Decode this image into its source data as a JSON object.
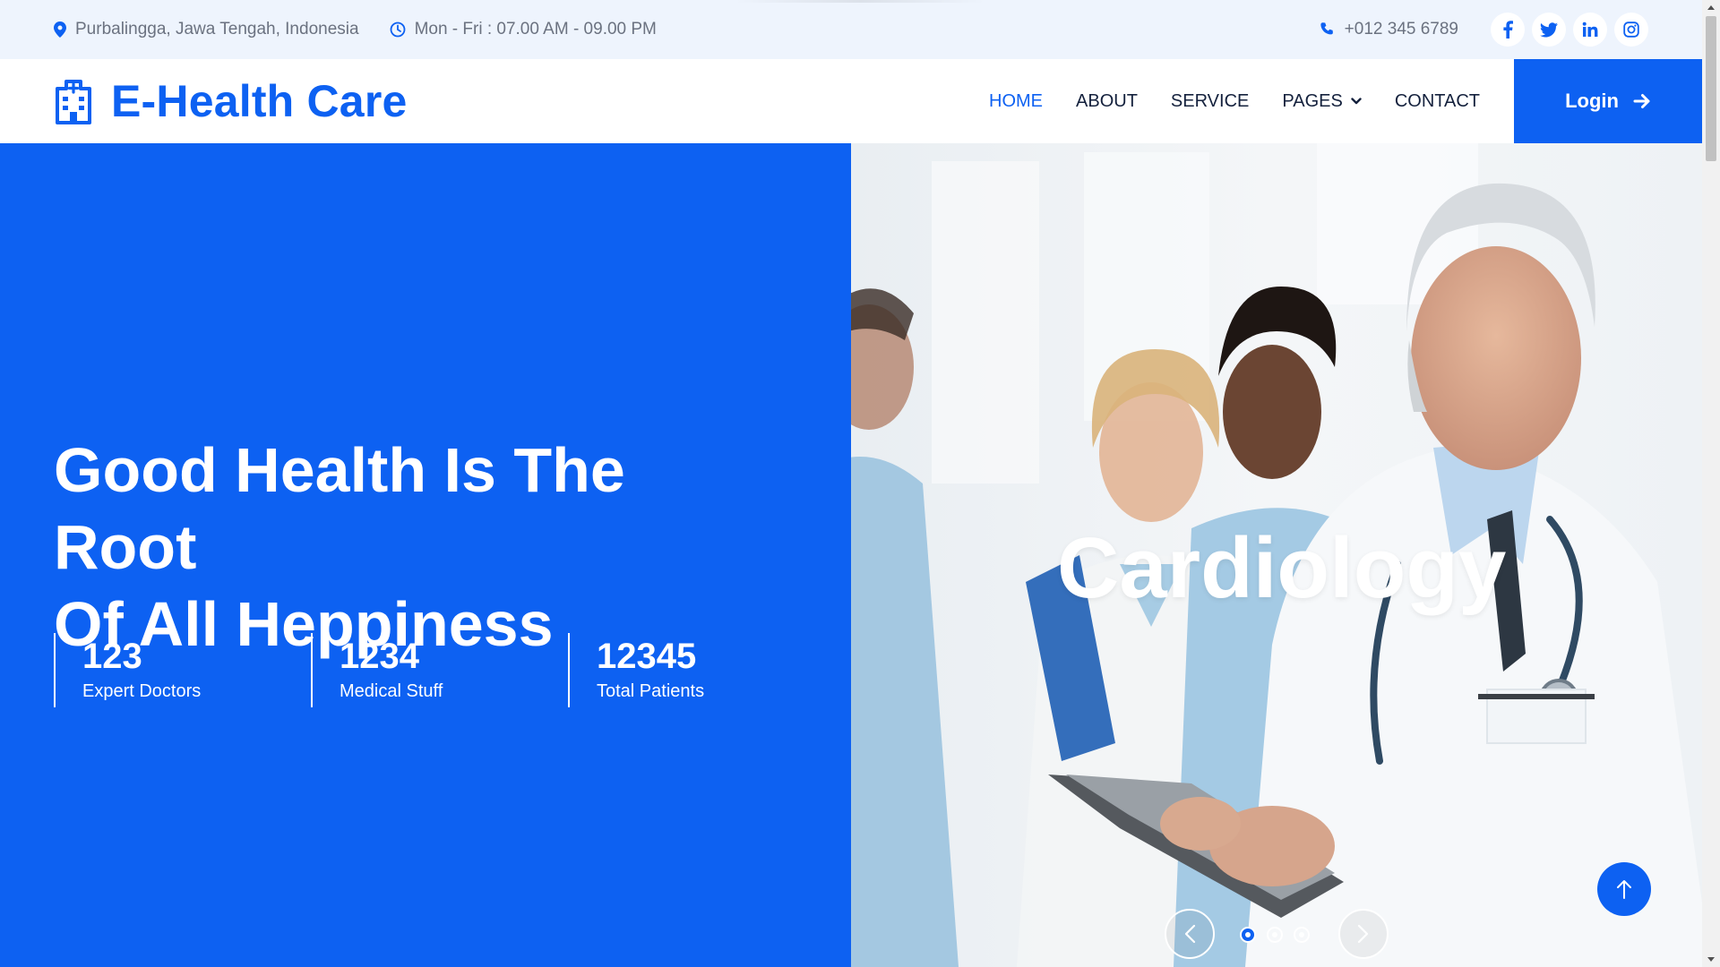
{
  "colors": {
    "primary": "#0d61f2",
    "topbar_bg": "#eef4fd",
    "text_dark": "#14213d",
    "text_muted": "#6b7280"
  },
  "topbar": {
    "location_icon": "map-pin-icon",
    "location": "Purbalingga, Jawa Tengah, Indonesia",
    "hours_icon": "clock-icon",
    "hours": "Mon - Fri : 07.00 AM - 09.00 PM",
    "phone_icon": "phone-icon",
    "phone": "+012 345 6789",
    "social": [
      "facebook-icon",
      "twitter-icon",
      "linkedin-icon",
      "instagram-icon"
    ]
  },
  "navbar": {
    "brand_icon": "hospital-icon",
    "brand": "E-Health Care",
    "links": [
      {
        "label": "HOME",
        "active": true
      },
      {
        "label": "ABOUT",
        "active": false
      },
      {
        "label": "SERVICE",
        "active": false
      },
      {
        "label": "PAGES",
        "active": false,
        "dropdown": true
      },
      {
        "label": "CONTACT",
        "active": false
      }
    ],
    "login_label": "Login",
    "login_icon": "arrow-right-icon"
  },
  "hero": {
    "title_line1": "Good Health Is The Root",
    "title_line2": "Of All Heppiness",
    "stats": [
      {
        "value": "123",
        "label": "Expert Doctors"
      },
      {
        "value": "1234",
        "label": "Medical Stuff"
      },
      {
        "value": "12345",
        "label": "Total Patients"
      }
    ]
  },
  "carousel": {
    "slide_label": "Cardiology",
    "slide_count": 3,
    "active_slide": 1,
    "prev_icon": "chevron-left-icon",
    "next_icon": "chevron-right-icon"
  },
  "back_to_top_icon": "arrow-up-icon"
}
